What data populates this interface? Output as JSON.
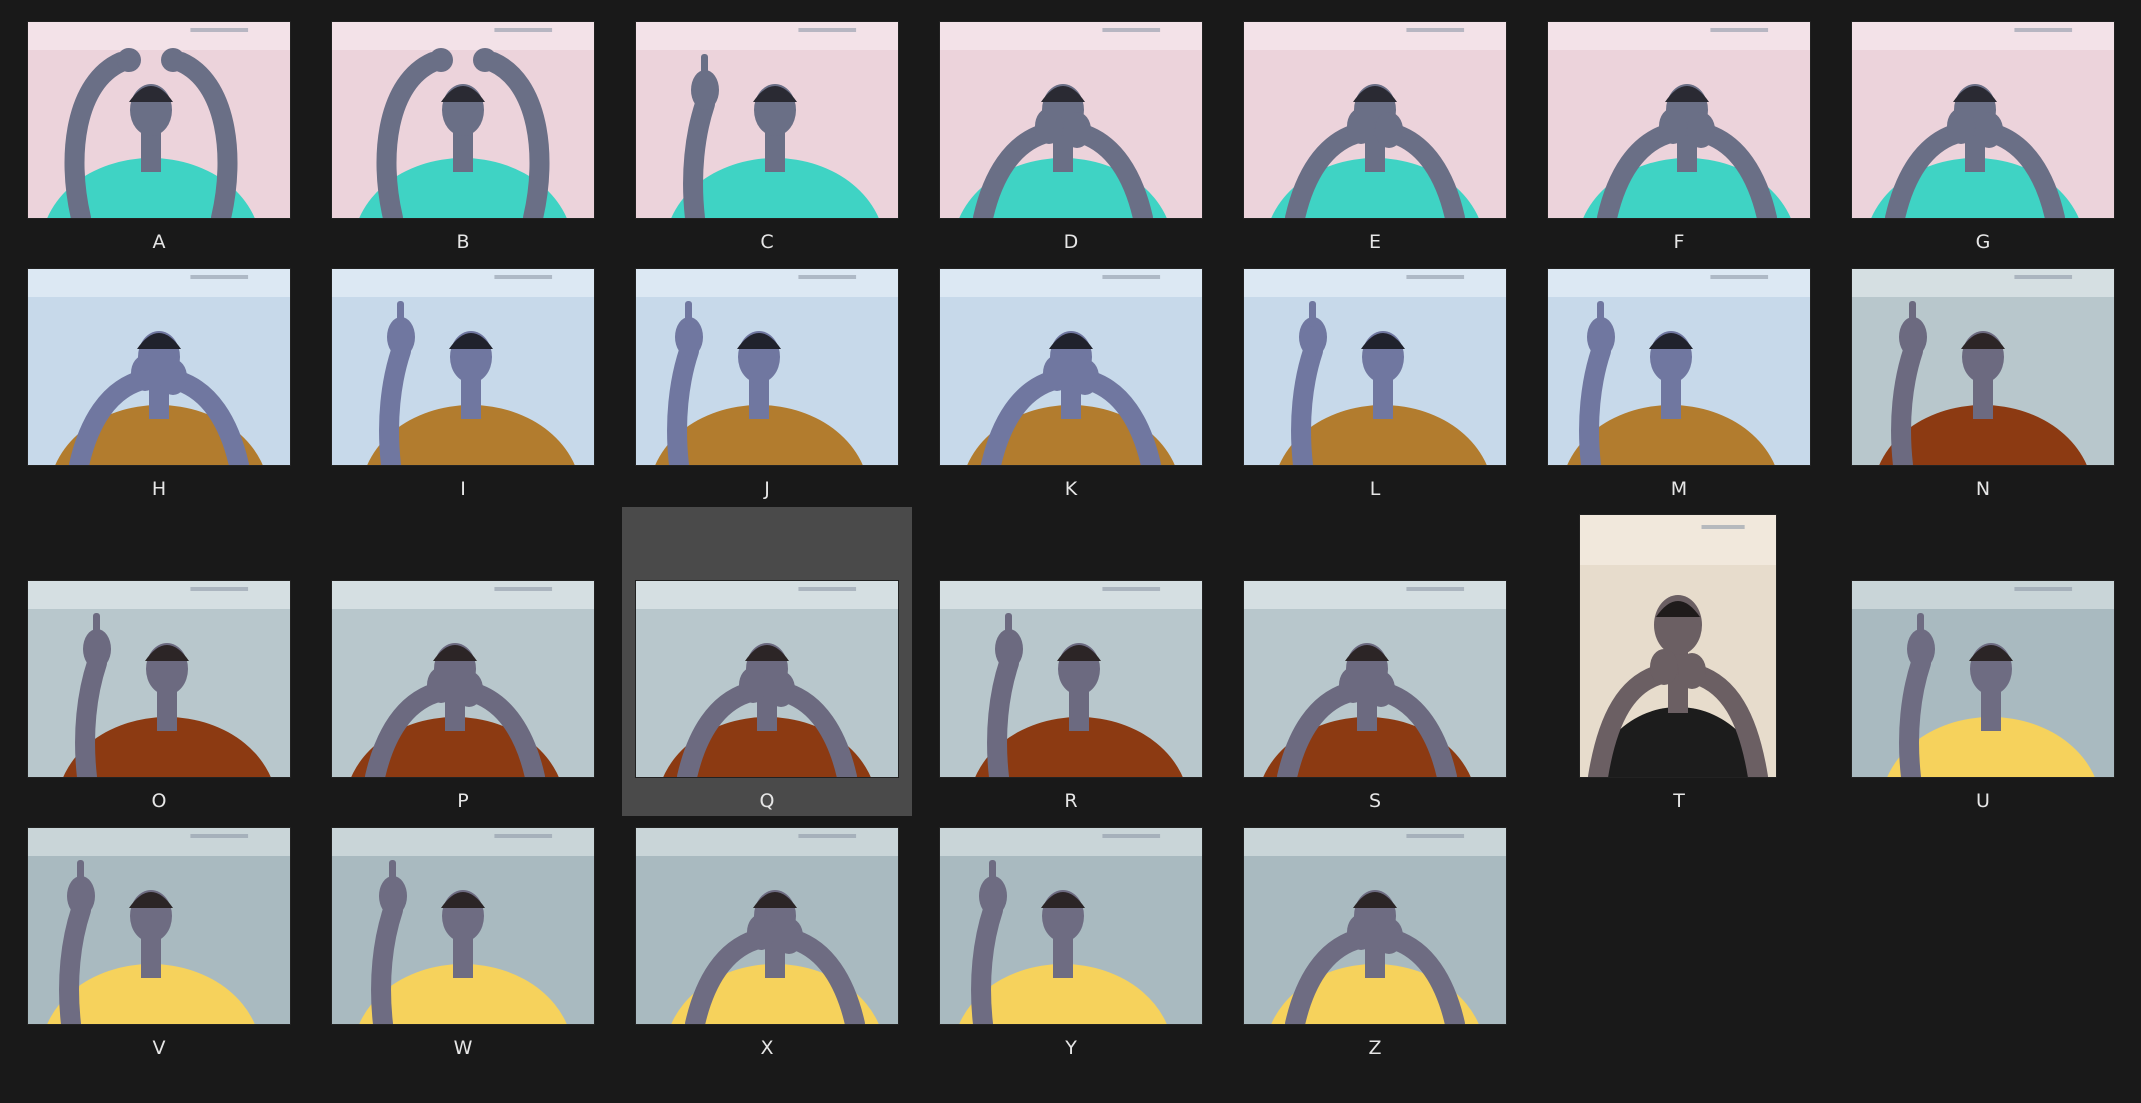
{
  "gallery": {
    "items": [
      {
        "label": "A",
        "scene": "pink",
        "pose": "arms-up"
      },
      {
        "label": "B",
        "scene": "pink",
        "pose": "arms-up"
      },
      {
        "label": "C",
        "scene": "pink",
        "pose": "one-hand"
      },
      {
        "label": "D",
        "scene": "pink",
        "pose": "two-hands"
      },
      {
        "label": "E",
        "scene": "pink",
        "pose": "two-hands"
      },
      {
        "label": "F",
        "scene": "pink",
        "pose": "two-hands"
      },
      {
        "label": "G",
        "scene": "pink",
        "pose": "two-hands"
      },
      {
        "label": "H",
        "scene": "blue-room",
        "pose": "two-hands"
      },
      {
        "label": "I",
        "scene": "blue-room",
        "pose": "one-hand"
      },
      {
        "label": "J",
        "scene": "blue-room",
        "pose": "one-hand"
      },
      {
        "label": "K",
        "scene": "blue-room",
        "pose": "two-hands"
      },
      {
        "label": "L",
        "scene": "blue-room",
        "pose": "one-hand"
      },
      {
        "label": "M",
        "scene": "blue-room",
        "pose": "one-hand"
      },
      {
        "label": "N",
        "scene": "hall-maroon",
        "pose": "one-hand"
      },
      {
        "label": "O",
        "scene": "hall-maroon",
        "pose": "one-hand"
      },
      {
        "label": "P",
        "scene": "hall-maroon",
        "pose": "two-hands"
      },
      {
        "label": "Q",
        "scene": "hall-maroon",
        "pose": "two-hands",
        "selected": true
      },
      {
        "label": "R",
        "scene": "hall-maroon",
        "pose": "one-hand"
      },
      {
        "label": "S",
        "scene": "hall-maroon",
        "pose": "two-hands"
      },
      {
        "label": "T",
        "scene": "cream-black",
        "pose": "two-hands",
        "portrait": true
      },
      {
        "label": "U",
        "scene": "hall-yellow",
        "pose": "one-hand"
      },
      {
        "label": "V",
        "scene": "hall-yellow",
        "pose": "one-hand"
      },
      {
        "label": "W",
        "scene": "hall-yellow",
        "pose": "one-hand"
      },
      {
        "label": "X",
        "scene": "hall-yellow",
        "pose": "two-hands"
      },
      {
        "label": "Y",
        "scene": "hall-yellow",
        "pose": "one-hand"
      },
      {
        "label": "Z",
        "scene": "hall-yellow",
        "pose": "two-hands"
      }
    ]
  },
  "scenes": {
    "pink": {
      "wall": "#ecd3db",
      "ceiling": "#f3e2e8",
      "shirt": "#3fd3c4",
      "skin": "#6a6f86",
      "hair": "#2a2a33"
    },
    "blue-room": {
      "wall": "#c7d9ea",
      "ceiling": "#dce8f3",
      "shirt": "#b27c2e",
      "skin": "#7077a0",
      "hair": "#20222c"
    },
    "hall-maroon": {
      "wall": "#b8c7cc",
      "ceiling": "#d5dfe2",
      "shirt": "#8c3a12",
      "skin": "#6c6a80",
      "hair": "#2c2526"
    },
    "hall-yellow": {
      "wall": "#a9bac0",
      "ceiling": "#c9d5d8",
      "shirt": "#f6d25c",
      "skin": "#6e6c82",
      "hair": "#2b2526"
    },
    "cream-black": {
      "wall": "#e7dccc",
      "ceiling": "#f1e8dc",
      "shirt": "#1c1c1c",
      "skin": "#6b5f63",
      "hair": "#1f1b1b"
    }
  }
}
